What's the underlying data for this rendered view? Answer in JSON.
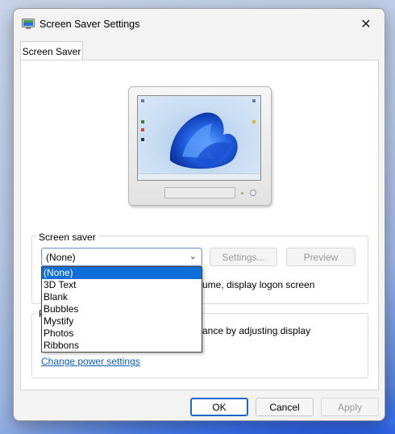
{
  "window": {
    "title": "Screen Saver Settings",
    "close_glyph": "✕"
  },
  "tabs": [
    {
      "label": "Screen Saver",
      "selected": true
    }
  ],
  "screen_saver": {
    "group_label": "Screen saver",
    "selected_value": "(None)",
    "settings_label": "Settings...",
    "preview_label": "Preview",
    "resume_text": "ume, display logon screen",
    "options": [
      "(None)",
      "3D Text",
      "Blank",
      "Bubbles",
      "Mystify",
      "Photos",
      "Ribbons"
    ]
  },
  "power": {
    "group_label_initial": "P",
    "text": "ance by adjusting display",
    "link": "Change power settings"
  },
  "footer": {
    "ok": "OK",
    "cancel": "Cancel",
    "apply": "Apply"
  },
  "colors": {
    "accent": "#0f6fd8",
    "link": "#0b5cb8",
    "dialog_bg": "#f3f3f3",
    "panel_bg": "#ffffff"
  },
  "icons": {
    "app": "monitor-app-icon",
    "close": "close-icon",
    "dropdown": "chevron-down-icon"
  }
}
